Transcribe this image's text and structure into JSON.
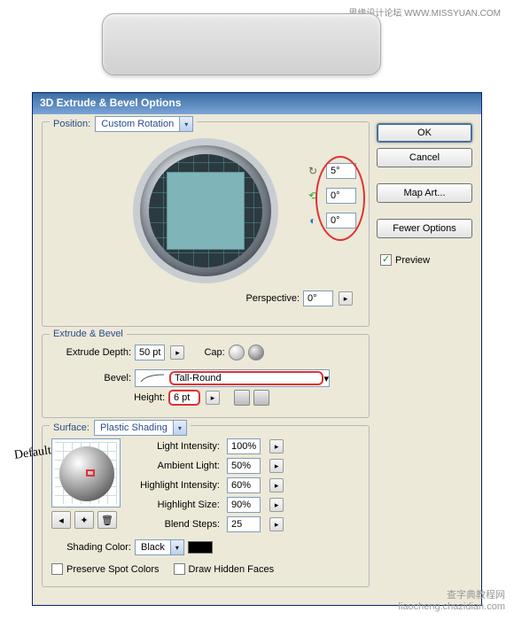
{
  "watermarks": {
    "top": "思缘设计论坛  WWW.MISSYUAN.COM",
    "bottom_cn": "查字典教程网",
    "bottom_url": "liaocheng.chazidian.com"
  },
  "dialog": {
    "title": "3D Extrude & Bevel Options",
    "buttons": {
      "ok": "OK",
      "cancel": "Cancel",
      "map_art": "Map Art...",
      "fewer": "Fewer Options"
    },
    "preview_label": "Preview"
  },
  "position": {
    "legend": "Position:",
    "rotation_preset": "Custom Rotation",
    "rot_x": "5°",
    "rot_y": "0°",
    "rot_z": "0°",
    "perspective_label": "Perspective:",
    "perspective_value": "0°"
  },
  "extrude": {
    "legend": "Extrude & Bevel",
    "depth_label": "Extrude Depth:",
    "depth_value": "50 pt",
    "cap_label": "Cap:",
    "bevel_label": "Bevel:",
    "bevel_value": "Tall-Round",
    "height_label": "Height:",
    "height_value": "6 pt"
  },
  "surface": {
    "label": "Surface:",
    "value": "Plastic Shading",
    "annotation": "Default",
    "light_intensity_label": "Light Intensity:",
    "light_intensity": "100%",
    "ambient_label": "Ambient Light:",
    "ambient": "50%",
    "highlight_intensity_label": "Highlight Intensity:",
    "highlight_intensity": "60%",
    "highlight_size_label": "Highlight Size:",
    "highlight_size": "90%",
    "blend_steps_label": "Blend Steps:",
    "blend_steps": "25",
    "shading_color_label": "Shading Color:",
    "shading_color": "Black",
    "preserve_spot": "Preserve Spot Colors",
    "draw_hidden": "Draw Hidden Faces"
  }
}
